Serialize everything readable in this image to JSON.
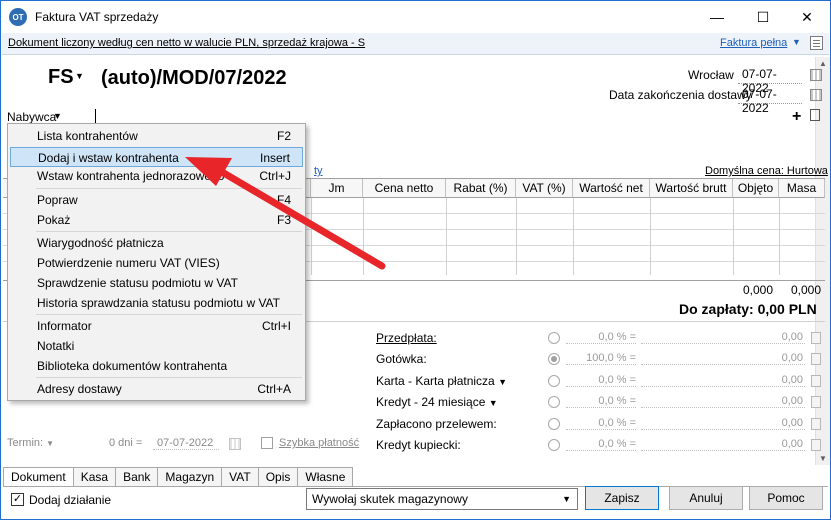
{
  "window": {
    "title": "Faktura VAT sprzedaży",
    "app_icon": "OT"
  },
  "infobar": {
    "text": "Dokument liczony według cen netto w walucie PLN, sprzedaż krajowa - S",
    "full_invoice": "Faktura pełna"
  },
  "header": {
    "doc_type": "FS",
    "doc_number": "(auto)/MOD/07/2022",
    "city": "Wrocław",
    "issue_date": "07-07-2022",
    "delivery_label": "Data zakończenia dostawy",
    "delivery_date": "07-07-2022"
  },
  "buyer": {
    "label": "Nabywca"
  },
  "grid": {
    "default_price": "Domyślna cena: Hurtowa",
    "vat_link": "ty",
    "columns": [
      "Jm",
      "Cena netto",
      "Rabat (%)",
      "VAT (%)",
      "Wartość net",
      "Wartość brutt",
      "Objęto",
      "Masa"
    ],
    "totals": [
      "0,000",
      "0,000"
    ]
  },
  "to_pay": "Do zapłaty: 0,00 PLN",
  "payments": [
    {
      "label": "Przedpłata:",
      "pct": "0,0 % =",
      "amount": "0,00",
      "checked": false,
      "dropdown": false,
      "underline": true
    },
    {
      "label": "Gotówka:",
      "pct": "100,0 % =",
      "amount": "0,00",
      "checked": true,
      "dropdown": false,
      "underline": false
    },
    {
      "label": "Karta - Karta płatnicza",
      "pct": "0,0 % =",
      "amount": "0,00",
      "checked": false,
      "dropdown": true,
      "underline": false
    },
    {
      "label": "Kredyt - 24 miesiące",
      "pct": "0,0 % =",
      "amount": "0,00",
      "checked": false,
      "dropdown": true,
      "underline": false
    },
    {
      "label": "Zapłacono przelewem:",
      "pct": "0,0 % =",
      "amount": "0,00",
      "checked": false,
      "dropdown": false,
      "underline": false
    },
    {
      "label": "Kredyt kupiecki:",
      "pct": "0,0 % =",
      "amount": "0,00",
      "checked": false,
      "dropdown": false,
      "underline": false
    }
  ],
  "term": {
    "label": "Termin:",
    "days": "0 dni =",
    "date": "07-07-2022",
    "quick_payment": "Szybka płatność"
  },
  "tabs": [
    "Dokument",
    "Kasa",
    "Bank",
    "Magazyn",
    "VAT",
    "Opis",
    "Własne"
  ],
  "footer": {
    "add_action": "Dodaj działanie",
    "warehouse_select": "Wywołaj skutek magazynowy",
    "save": "Zapisz",
    "cancel": "Anuluj",
    "help": "Pomoc"
  },
  "menu": {
    "items": [
      {
        "label": "Lista kontrahentów",
        "shortcut": "F2"
      },
      {
        "label": "Dodaj i wstaw kontrahenta",
        "shortcut": "Insert"
      },
      {
        "label": "Wstaw kontrahenta jednorazowego",
        "shortcut": "Ctrl+J"
      },
      {
        "label": "Popraw",
        "shortcut": "F4"
      },
      {
        "label": "Pokaż",
        "shortcut": "F3"
      },
      {
        "label": "Wiarygodność płatnicza",
        "shortcut": ""
      },
      {
        "label": "Potwierdzenie numeru VAT (VIES)",
        "shortcut": ""
      },
      {
        "label": "Sprawdzenie statusu podmiotu w VAT",
        "shortcut": ""
      },
      {
        "label": "Historia sprawdzania statusu podmiotu w VAT",
        "shortcut": ""
      },
      {
        "label": "Informator",
        "shortcut": "Ctrl+I"
      },
      {
        "label": "Notatki",
        "shortcut": ""
      },
      {
        "label": "Biblioteka dokumentów kontrahenta",
        "shortcut": ""
      },
      {
        "label": "Adresy dostawy",
        "shortcut": "Ctrl+A"
      }
    ],
    "highlighted": "Dodaj i wstaw kontrahenta"
  },
  "annotation_color": "#e8262a"
}
